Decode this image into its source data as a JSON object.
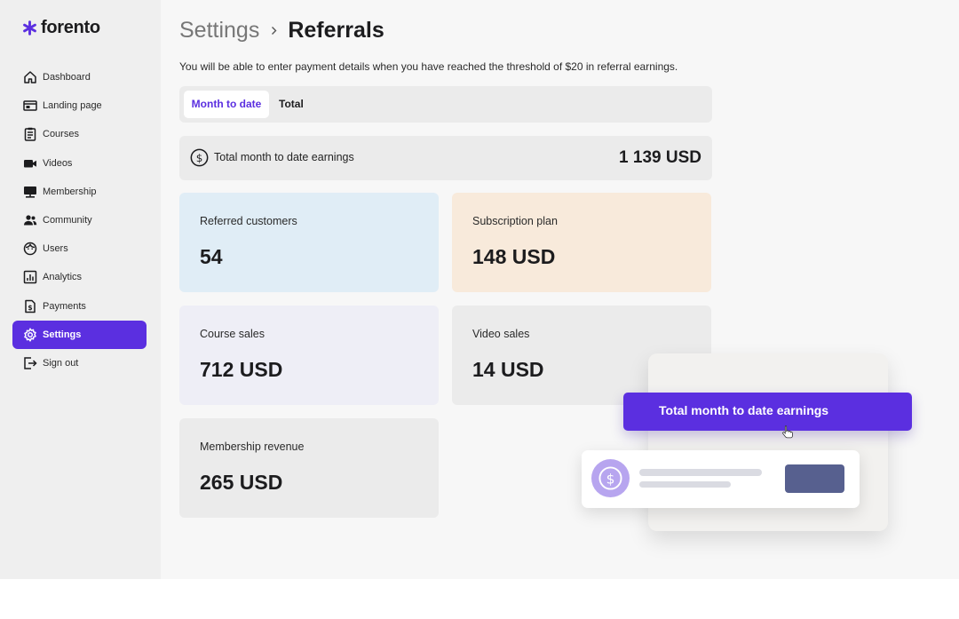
{
  "brand": {
    "name": "forento",
    "accent": "#5b2fe0"
  },
  "sidebar": {
    "items": [
      {
        "label": "Dashboard",
        "icon": "home-icon",
        "active": false
      },
      {
        "label": "Landing page",
        "icon": "landing-page-icon",
        "active": false
      },
      {
        "label": "Courses",
        "icon": "courses-icon",
        "active": false
      },
      {
        "label": "Videos",
        "icon": "video-camera-icon",
        "active": false
      },
      {
        "label": "Membership",
        "icon": "membership-icon",
        "active": false
      },
      {
        "label": "Community",
        "icon": "community-icon",
        "active": false
      },
      {
        "label": "Users",
        "icon": "users-icon",
        "active": false
      },
      {
        "label": "Analytics",
        "icon": "analytics-icon",
        "active": false
      },
      {
        "label": "Payments",
        "icon": "payments-icon",
        "active": false
      },
      {
        "label": "Settings",
        "icon": "gear-icon",
        "active": true
      },
      {
        "label": "Sign out",
        "icon": "sign-out-icon",
        "active": false
      }
    ]
  },
  "header": {
    "breadcrumb_parent": "Settings",
    "breadcrumb_current": "Referrals"
  },
  "notice": "You will be able to enter payment details when you have reached the threshold of $20 in referral earnings.",
  "tabs": [
    {
      "label": "Month to date",
      "active": true
    },
    {
      "label": "Total",
      "active": false
    }
  ],
  "total": {
    "label": "Total month to date earnings",
    "value": "1 139 USD",
    "icon": "dollar-circle-icon"
  },
  "cards": [
    {
      "label": "Referred customers",
      "value": "54",
      "color": "#e0edf6"
    },
    {
      "label": "Subscription plan",
      "value": "148 USD",
      "color": "#f8eadb"
    },
    {
      "label": "Course sales",
      "value": "712 USD",
      "color": "#eeeef6"
    },
    {
      "label": "Video sales",
      "value": "14 USD",
      "color": "#ebebeb"
    },
    {
      "label": "Membership revenue",
      "value": "265 USD",
      "color": "#ebebeb"
    }
  ],
  "illustration": {
    "banner_text": "Total month to date earnings"
  }
}
